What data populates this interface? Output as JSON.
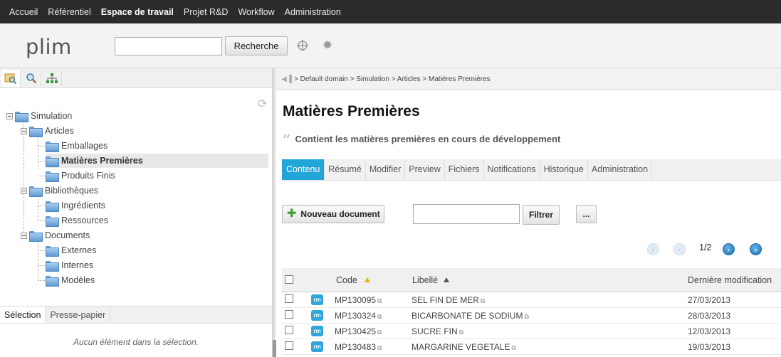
{
  "topnav": [
    "Accueil",
    "Référentiel",
    "Espace de travail",
    "Projet R&D",
    "Workflow",
    "Administration"
  ],
  "header": {
    "logo": "plim",
    "search_button": "Recherche",
    "search_value": ""
  },
  "leftpane": {
    "tree": [
      {
        "label": "Simulation",
        "level": 0,
        "toggle": true
      },
      {
        "label": "Articles",
        "level": 1,
        "toggle": true
      },
      {
        "label": "Emballages",
        "level": 2
      },
      {
        "label": "Matières Premières",
        "level": 2,
        "selected": true
      },
      {
        "label": "Produits Finis",
        "level": 2
      },
      {
        "label": "Bibliothèques",
        "level": 1,
        "toggle": true
      },
      {
        "label": "Ingrédients",
        "level": 2
      },
      {
        "label": "Ressources",
        "level": 2
      },
      {
        "label": "Documents",
        "level": 1,
        "toggle": true
      },
      {
        "label": "Externes",
        "level": 2
      },
      {
        "label": "Internes",
        "level": 2
      },
      {
        "label": "Modèles",
        "level": 2
      }
    ],
    "tabs": [
      "Sélection",
      "Presse-papier"
    ],
    "empty_selection": "Aucun élément dans la sélection."
  },
  "main": {
    "breadcrumb": "> Default domain > Simulation > Articles > Matières Premières",
    "title": "Matières Premières",
    "description": "Contient les matières premières en cours de développement",
    "tabs": [
      "Contenu",
      "Résumé",
      "Modifier",
      "Preview",
      "Fichiers",
      "Notifications",
      "Historique",
      "Administration"
    ],
    "new_document": "Nouveau document",
    "filter_button": "Filtrer",
    "more_button": "...",
    "filter_value": "",
    "pager": "1/2",
    "columns": {
      "code": "Code",
      "label": "Libellé",
      "date": "Dernière modification"
    },
    "icon_text": "rm",
    "rows": [
      {
        "code": "MP130095",
        "label": "SEL FIN DE MER",
        "date": "27/03/2013"
      },
      {
        "code": "MP130324",
        "label": "BICARBONATE DE SODIUM",
        "date": "28/03/2013"
      },
      {
        "code": "MP130425",
        "label": "SUCRE FIN",
        "date": "12/03/2013"
      },
      {
        "code": "MP130483",
        "label": "MARGARINE VEGETALE",
        "date": "19/03/2013"
      }
    ]
  },
  "colors": {
    "accent": "#22a6d8",
    "topnav_bg": "#2b2b2b",
    "icon_bg": "#2fa6dc"
  }
}
